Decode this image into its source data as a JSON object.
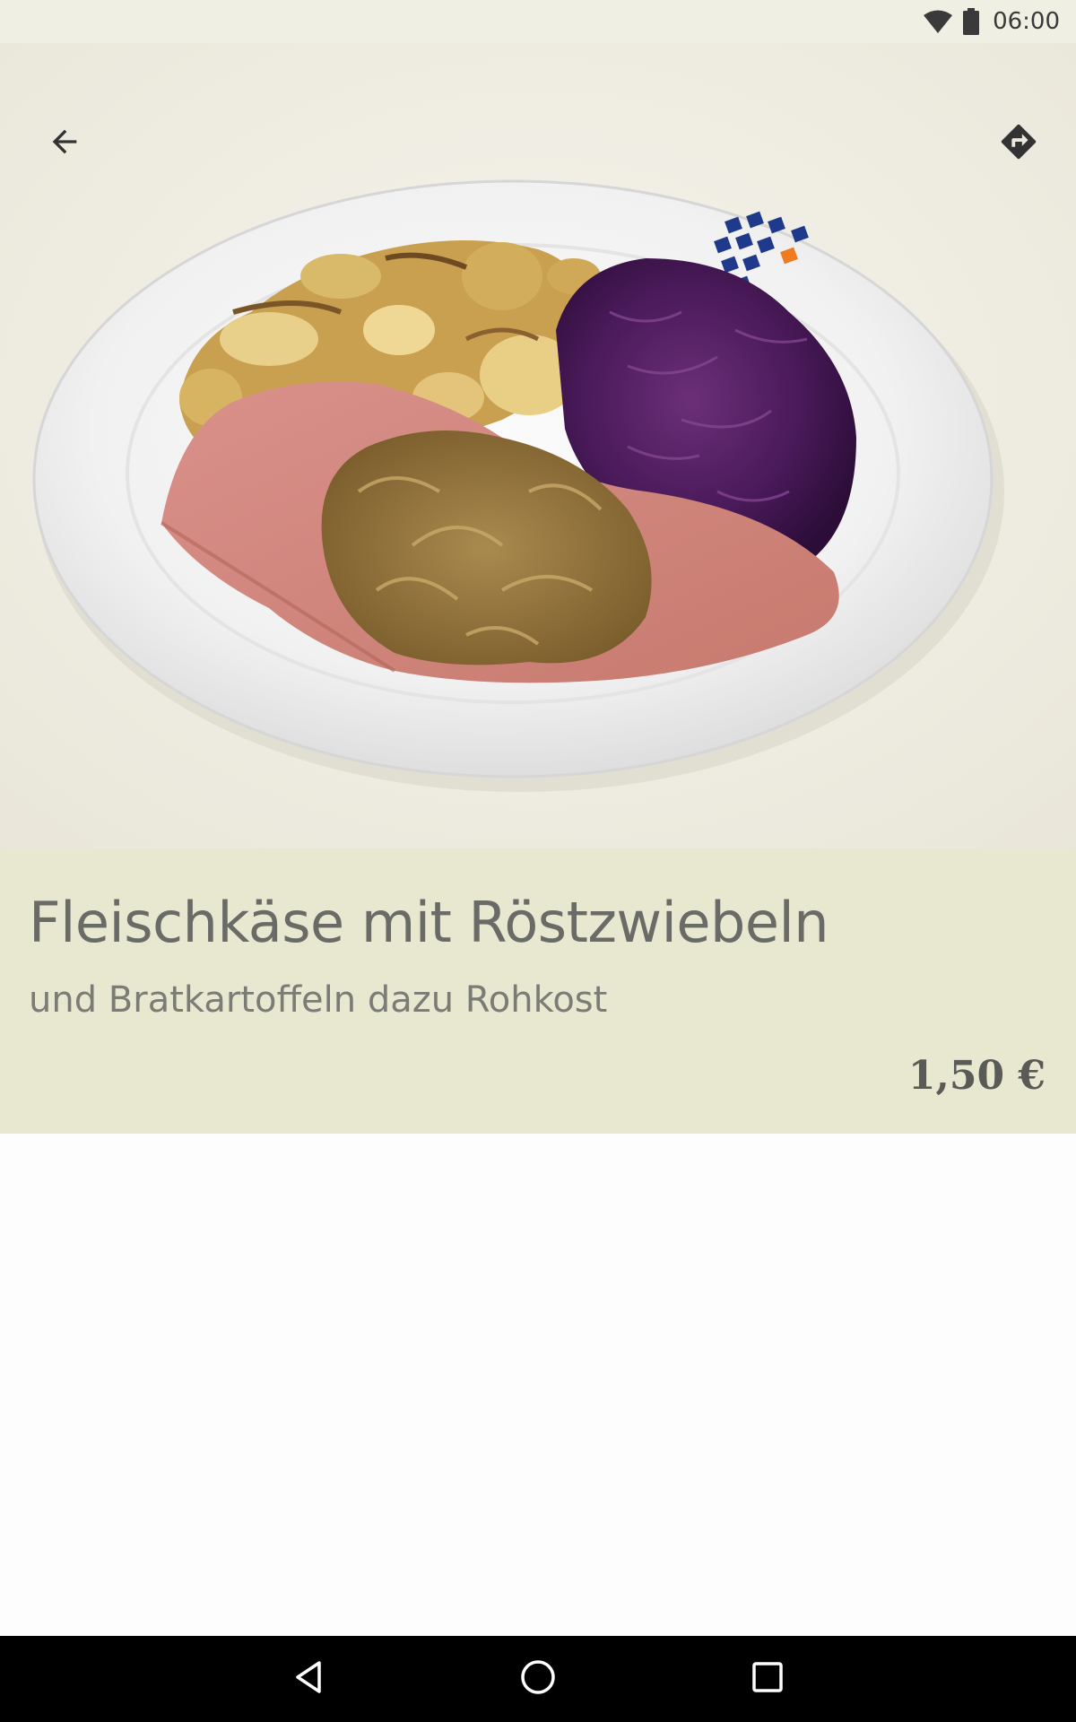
{
  "status_bar": {
    "time": "06:00",
    "icons": [
      "wifi-icon",
      "battery-icon"
    ]
  },
  "toolbar": {
    "back_icon": "arrow-back-icon",
    "directions_icon": "directions-icon"
  },
  "hero_image": {
    "description_icon": "dish-photo"
  },
  "dish": {
    "title": "Fleischkäse mit Röstzwiebeln",
    "subtitle": "und Bratkartoffeln dazu Rohkost",
    "price": "1,50 €"
  },
  "nav_bar": {
    "icons": [
      "nav-back-icon",
      "nav-home-icon",
      "nav-recents-icon"
    ]
  },
  "colors": {
    "status_bar_bg": "#efefe3",
    "info_panel_bg": "#e7e8cf",
    "title_text": "#6a6a66",
    "nav_bar_bg": "#000000"
  }
}
